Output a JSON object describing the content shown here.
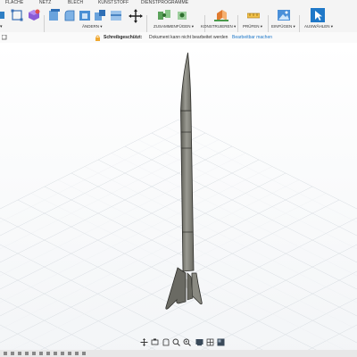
{
  "tabs": [
    {
      "label": "FLÄCHE"
    },
    {
      "label": "NETZ"
    },
    {
      "label": "BLECH"
    },
    {
      "label": "KUNSTSTOFF"
    },
    {
      "label": "DIENSTPROGRAMME"
    }
  ],
  "ribbon_groups": {
    "aendern": "ÄNDERN ▾",
    "zusammenfuegen": "ZUSAMMENFÜGEN ▾",
    "konstruieren": "KONSTRUIEREN ▾",
    "pruefen": "PRÜFEN ▾",
    "einfuegen": "EINFÜGEN ▾",
    "auswaehlen": "AUSWÄHLEN ▾"
  },
  "readonly_bar": {
    "label": "Schreibgeschützt:",
    "message": "Dokument kann nicht bearbeitet werden",
    "action": "Bearbeitbar machen"
  },
  "colors": {
    "accent": "#0696d7",
    "warning": "#f0a830",
    "rocket_body": "#7a7a70",
    "grid_line": "#d8dde2"
  },
  "icons": [
    "orbit-icon",
    "pan-icon",
    "look-at-icon",
    "zoom-icon",
    "fit-icon",
    "display-settings-icon",
    "grid-settings-icon",
    "viewports-icon"
  ]
}
